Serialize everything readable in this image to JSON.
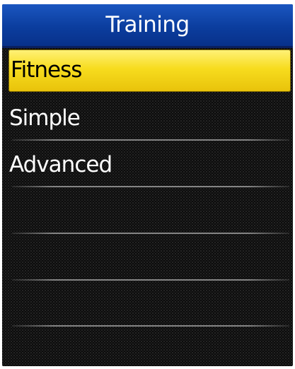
{
  "header": {
    "title": "Training"
  },
  "menu": {
    "items": [
      {
        "label": "Fitness",
        "selected": true
      },
      {
        "label": "Simple",
        "selected": false
      },
      {
        "label": "Advanced",
        "selected": false
      }
    ],
    "empty_rows": 4
  },
  "colors": {
    "title_bar": "#0b3d9e",
    "selection": "#f7dc1e",
    "background": "#0c0c0c",
    "text": "#ffffff",
    "selected_text": "#000000"
  }
}
